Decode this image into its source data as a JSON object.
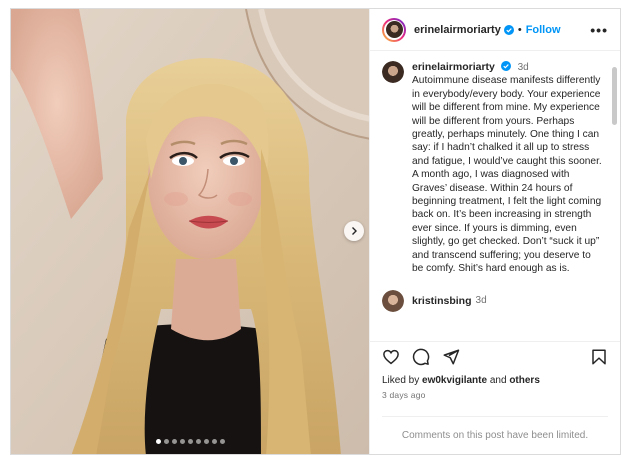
{
  "post": {
    "username": "erinelairmoriarty",
    "follow_label": "Follow",
    "dot": "•",
    "more_label": "•••",
    "caption_username": "erinelairmoriarty",
    "caption_time": "3d",
    "caption_text": "Autoimmune disease manifests differently in everybody/every body. Your experience will be different from mine. My experience will be different from yours. Perhaps greatly, perhaps minutely. One thing I can say: if I hadn’t chalked it all up to stress and fatigue, I would’ve caught this sooner. A month ago, I was diagnosed with Graves’ disease. Within 24 hours of beginning treatment, I felt the light coming back on. It’s been increasing in strength ever since. If yours is dimming, even slightly, go get checked. Don’t “suck it up” and transcend suffering; you deserve to be comfy. Shit’s hard enough as is.",
    "comment_username": "kristinsbing",
    "comment_time": "3d",
    "likes_prefix": "Liked by",
    "likes_user": "ew0kvigilante",
    "likes_and": "and",
    "likes_others": "others",
    "date": "3 days ago",
    "comments_limited": "Comments on this post have been limited."
  },
  "carousel": {
    "dot_count": 9,
    "active_index": 0
  },
  "icons": {
    "verified": "verified-badge-icon",
    "next": "chevron-right-icon",
    "like": "heart-icon",
    "comment": "comment-bubble-icon",
    "share": "paper-plane-icon",
    "save": "bookmark-icon"
  },
  "colors": {
    "accent": "#0095f6",
    "verified": "#0095f6",
    "text": "#262626",
    "muted": "#737373"
  }
}
